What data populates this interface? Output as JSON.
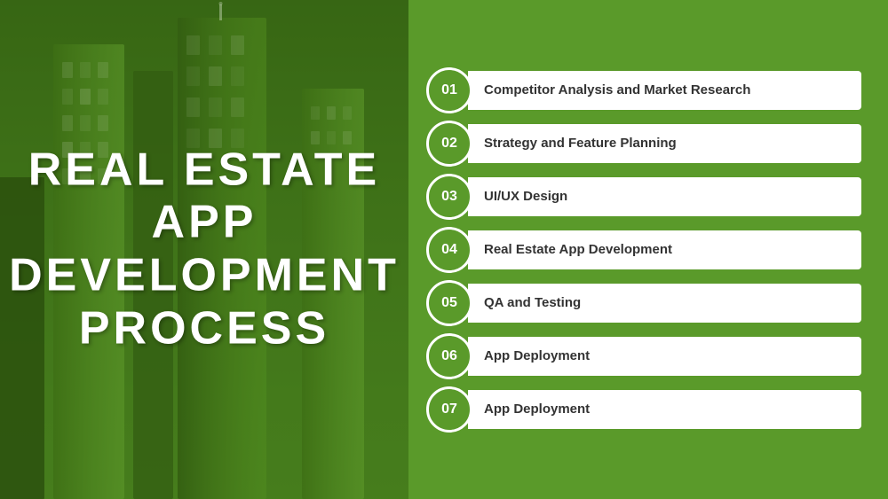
{
  "title": "Real Estate App Development Process",
  "left": {
    "line1": "REAL ESTATE",
    "line2": "APP",
    "line3": "DEVELOPMENT",
    "line4": "PROCESS"
  },
  "right": {
    "steps": [
      {
        "number": "01",
        "label": "Competitor Analysis and Market Research"
      },
      {
        "number": "02",
        "label": "Strategy and Feature Planning"
      },
      {
        "number": "03",
        "label": "UI/UX Design"
      },
      {
        "number": "04",
        "label": "Real Estate App Development"
      },
      {
        "number": "05",
        "label": "QA and Testing"
      },
      {
        "number": "06",
        "label": "App Deployment"
      },
      {
        "number": "07",
        "label": "App Deployment"
      }
    ]
  },
  "colors": {
    "green": "#5a9a2a",
    "darkGreen": "#3d6e1a",
    "white": "#ffffff",
    "text": "#333333"
  }
}
